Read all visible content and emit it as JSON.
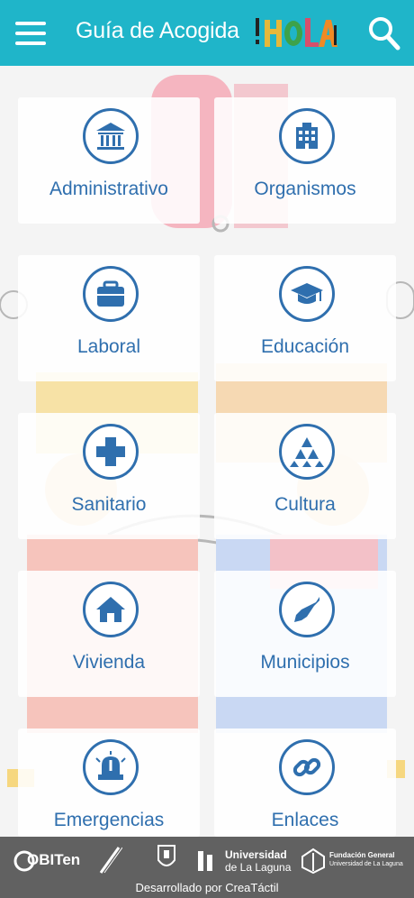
{
  "header": {
    "title": "Guía de Acogida",
    "logo_text": "¡HOLA!"
  },
  "grid": {
    "items": [
      {
        "label": "Administrativo"
      },
      {
        "label": "Organismos"
      },
      {
        "label": "Laboral"
      },
      {
        "label": "Educación"
      },
      {
        "label": "Sanitario"
      },
      {
        "label": "Cultura"
      },
      {
        "label": "Vivienda"
      },
      {
        "label": "Municipios"
      },
      {
        "label": "Emergencias"
      },
      {
        "label": "Enlaces"
      }
    ]
  },
  "footer": {
    "logo1": "OBITen",
    "logo4_line1": "Universidad",
    "logo4_line2": "de La Laguna",
    "logo5_line1": "Fundación General",
    "logo5_line2": "Universidad de La Laguna",
    "credits": "Desarrollado por CreaTáctil"
  },
  "colors": {
    "header_bg": "#1fb5c9",
    "accent": "#2f6fae",
    "footer_bg": "#616161"
  }
}
